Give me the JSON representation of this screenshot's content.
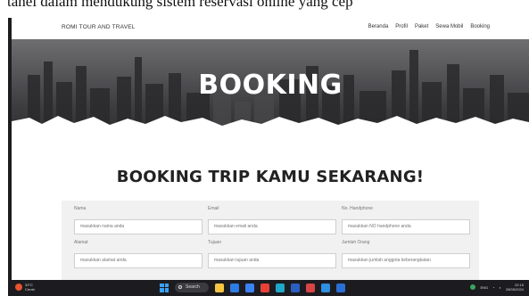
{
  "caption": "tanel dalam mendukung sistem reservasi online yang cep",
  "nav": {
    "brand": "ROMI TOUR AND TRAVEL",
    "links": [
      "Beranda",
      "Profil",
      "Paket",
      "Sewa Mobil",
      "Booking"
    ]
  },
  "hero": {
    "title": "BOOKING"
  },
  "section": {
    "title": "BOOKING TRIP KAMU SEKARANG!"
  },
  "form": {
    "fields": [
      {
        "label": "Nama",
        "placeholder": "masukkan nama anda"
      },
      {
        "label": "Email",
        "placeholder": "masukkan email anda"
      },
      {
        "label": "No. Handphone",
        "placeholder": "masukkan NO handphone anda"
      },
      {
        "label": "Alamat",
        "placeholder": "masukkan alamat anda"
      },
      {
        "label": "Tujuan",
        "placeholder": "masukkan tujuan anda"
      },
      {
        "label": "Jumlah Orang",
        "placeholder": "masukkan jumlah anggota keberangkatan"
      }
    ]
  },
  "taskbar": {
    "weather_temp": "33°C",
    "weather_desc": "Cerah",
    "search_label": "Search",
    "tray_lang": "ENG",
    "time": "22:15",
    "date": "28/05/2024",
    "apps": [
      {
        "name": "file-explorer-icon",
        "color": "#f5c542"
      },
      {
        "name": "mail-icon",
        "color": "#2d7be5"
      },
      {
        "name": "store-icon",
        "color": "#3b82f6"
      },
      {
        "name": "chrome-icon",
        "color": "#e94235"
      },
      {
        "name": "edge-icon",
        "color": "#1fa8c9"
      },
      {
        "name": "word-icon",
        "color": "#2b5fbf"
      },
      {
        "name": "app-red-icon",
        "color": "#d94444"
      },
      {
        "name": "vscode-icon",
        "color": "#2f8fe0"
      },
      {
        "name": "app-blue-icon",
        "color": "#2a6fd6"
      }
    ]
  }
}
